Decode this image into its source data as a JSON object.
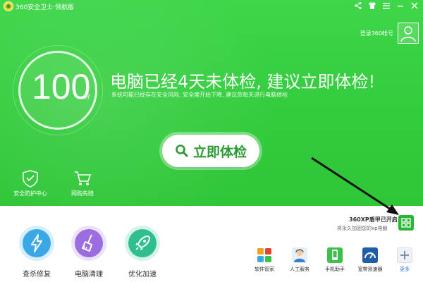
{
  "window": {
    "title": "360安全卫士·领航版",
    "controls": [
      "share-icon",
      "skin-icon",
      "menu-icon",
      "minimize-icon",
      "close-icon"
    ]
  },
  "account": {
    "login_label": "登录360帐号"
  },
  "score": {
    "value": "100",
    "unit": "分"
  },
  "status": {
    "headline": "电脑已经4天未体检, 建议立即体检!",
    "subline": "系统可能已经存在安全风险, 安全度开始下降, 建议您每天进行电脑体检"
  },
  "check_button": {
    "label": "立即体检"
  },
  "left_tools": [
    {
      "label": "安全防护中心",
      "icon": "shield-icon"
    },
    {
      "label": "网购先赔",
      "icon": "cart-icon"
    }
  ],
  "features": [
    {
      "label": "查杀修复",
      "icon": "lightning-icon",
      "color": "#3aa7e6"
    },
    {
      "label": "电脑清理",
      "icon": "broom-icon",
      "color": "#9b6de0"
    },
    {
      "label": "优化加速",
      "icon": "rocket-icon",
      "color": "#2fbf8e"
    }
  ],
  "xp_shield": {
    "title": "360XP盾甲已开启",
    "subtitle": "将永久加固您的xp电脑"
  },
  "apps": [
    {
      "label": "软件管家",
      "icon": "software-manager-icon"
    },
    {
      "label": "人工服务",
      "icon": "human-service-icon"
    },
    {
      "label": "手机助手",
      "icon": "phone-assistant-icon"
    },
    {
      "label": "宽带测速器",
      "icon": "speed-test-icon"
    },
    {
      "label": "更多",
      "icon": "more-icon"
    }
  ],
  "colors": {
    "brand_green": "#33cc3d",
    "button_text": "#2b9b34",
    "more_link": "#2a7fd6"
  }
}
